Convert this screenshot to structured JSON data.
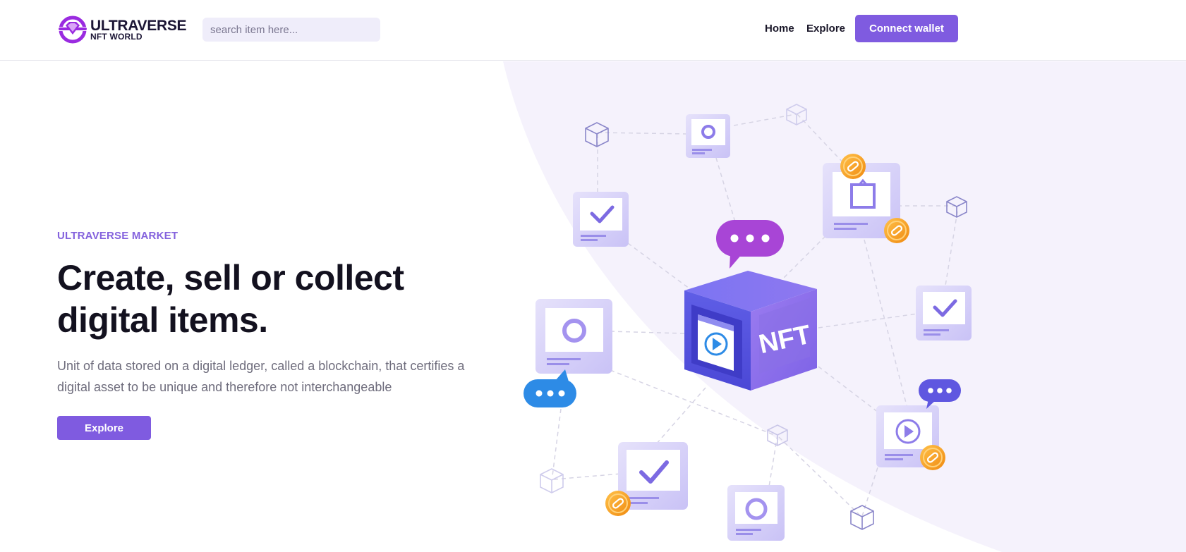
{
  "brand": {
    "name_line1": "ULTRAVERSE",
    "name_line2": "NFT WORLD",
    "accent": "#7f5be0",
    "logo_icon": "diamond-logo-icon"
  },
  "search": {
    "placeholder": "search item here...",
    "value": ""
  },
  "nav": {
    "home": "Home",
    "explore": "Explore",
    "connect": "Connect wallet"
  },
  "hero": {
    "eyebrow": "ULTRAVERSE MARKET",
    "headline": "Create, sell or collect digital items.",
    "description": "Unit of data stored on a digital ledger, called a blockchain, that certifies a digital asset to be unique and therefore not interchangeable",
    "cta": "Explore",
    "cube_label": "NFT"
  },
  "colors": {
    "heading": "#13111f",
    "body_text": "#6e6c7c",
    "eyebrow": "#8462dd",
    "hero_background": "#f5f2fc",
    "card": "#dcd8fa",
    "coin": "#f6a623",
    "chat_blue": "#2d8be6",
    "chat_purple": "#a845d6"
  }
}
